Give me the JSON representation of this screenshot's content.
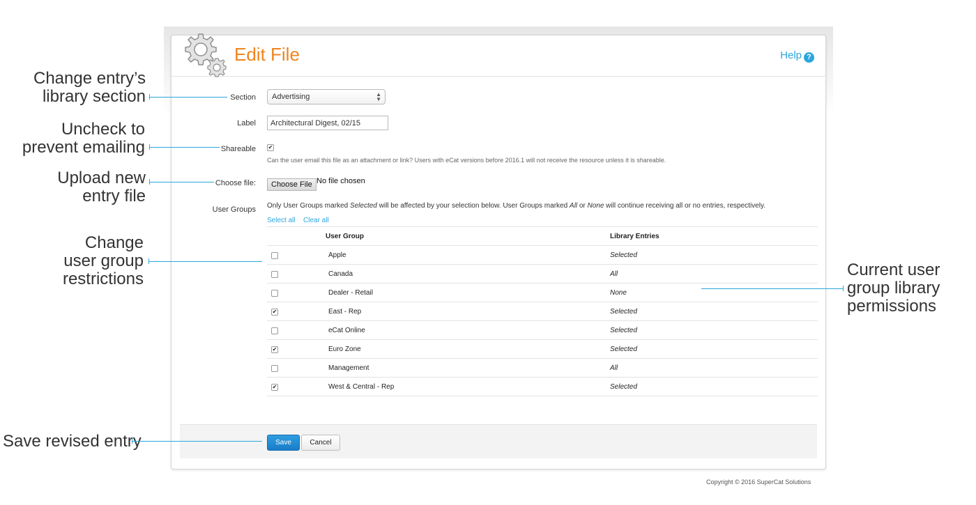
{
  "page": {
    "title": "Edit File",
    "help_label": "Help",
    "help_icon": "question-circle-icon",
    "accent_color": "#f0841e",
    "link_color": "#2ba6de"
  },
  "form": {
    "section": {
      "label": "Section",
      "value": "Advertising"
    },
    "label": {
      "label": "Label",
      "value": "Architectural Digest, 02/15"
    },
    "shareable": {
      "label": "Shareable",
      "checked": true,
      "help_text": "Can the user email this file as an attachment or link? Users with eCat versions before 2016.1 will not receive the resource unless it is shareable."
    },
    "choose_file": {
      "label": "Choose file:",
      "button_label": "Choose File",
      "status": "No file chosen"
    },
    "user_groups": {
      "label": "User Groups",
      "note_parts": [
        "Only User Groups marked ",
        "Selected",
        " will be affected by your selection below. User Groups marked ",
        "All",
        " or ",
        "None",
        " will continue receiving all or no entries, respectively."
      ],
      "select_all": "Select all",
      "clear_all": "Clear all",
      "columns": [
        "User Group",
        "Library Entries"
      ],
      "rows": [
        {
          "checked": false,
          "group": "Apple",
          "library": "Selected"
        },
        {
          "checked": false,
          "group": "Canada",
          "library": "All"
        },
        {
          "checked": false,
          "group": "Dealer - Retail",
          "library": "None"
        },
        {
          "checked": true,
          "group": "East - Rep",
          "library": "Selected"
        },
        {
          "checked": false,
          "group": "eCat Online",
          "library": "Selected"
        },
        {
          "checked": true,
          "group": "Euro Zone",
          "library": "Selected"
        },
        {
          "checked": false,
          "group": "Management",
          "library": "All"
        },
        {
          "checked": true,
          "group": "West & Central - Rep",
          "library": "Selected"
        }
      ]
    }
  },
  "actions": {
    "save": "Save",
    "cancel": "Cancel"
  },
  "copyright": "Copyright © 2016 SuperCat Solutions",
  "callouts": {
    "section": [
      "Change entry’s",
      "library section"
    ],
    "shareable": [
      "Uncheck to",
      "prevent emailing"
    ],
    "upload": [
      "Upload new",
      "entry file"
    ],
    "groups": [
      "Change",
      "user group",
      "restrictions"
    ],
    "permissions": [
      "Current user",
      "group library",
      "permissions"
    ],
    "save": [
      "Save revised entry"
    ]
  }
}
